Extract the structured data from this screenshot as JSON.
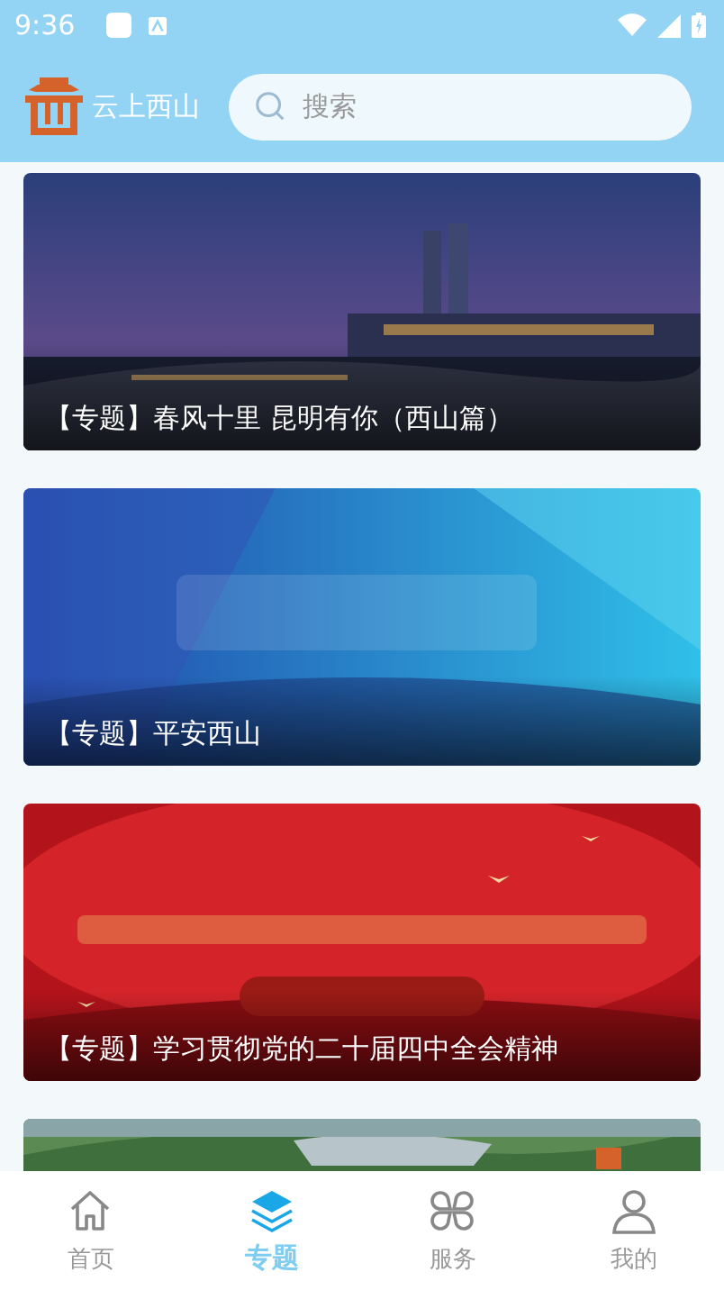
{
  "status_bar": {
    "time": "9:36"
  },
  "header": {
    "app_name": "云上西山",
    "search": {
      "placeholder": "搜索"
    }
  },
  "topics": [
    {
      "kind": "picture",
      "caption": "【专题】春风十里 昆明有你（西山篇）"
    },
    {
      "kind": "picture",
      "caption": "【专题】平安西山"
    },
    {
      "kind": "picture",
      "caption": "【专题】学习贯彻党的二十届四中全会精神"
    },
    {
      "kind": "picture"
    }
  ],
  "tab_bar": [
    {
      "kind": "home",
      "label": "首页",
      "selected": false
    },
    {
      "kind": "layers",
      "label": "专题",
      "selected": true
    },
    {
      "kind": "grid",
      "label": "服务",
      "selected": false
    },
    {
      "kind": "person",
      "label": "我的",
      "selected": false
    }
  ]
}
